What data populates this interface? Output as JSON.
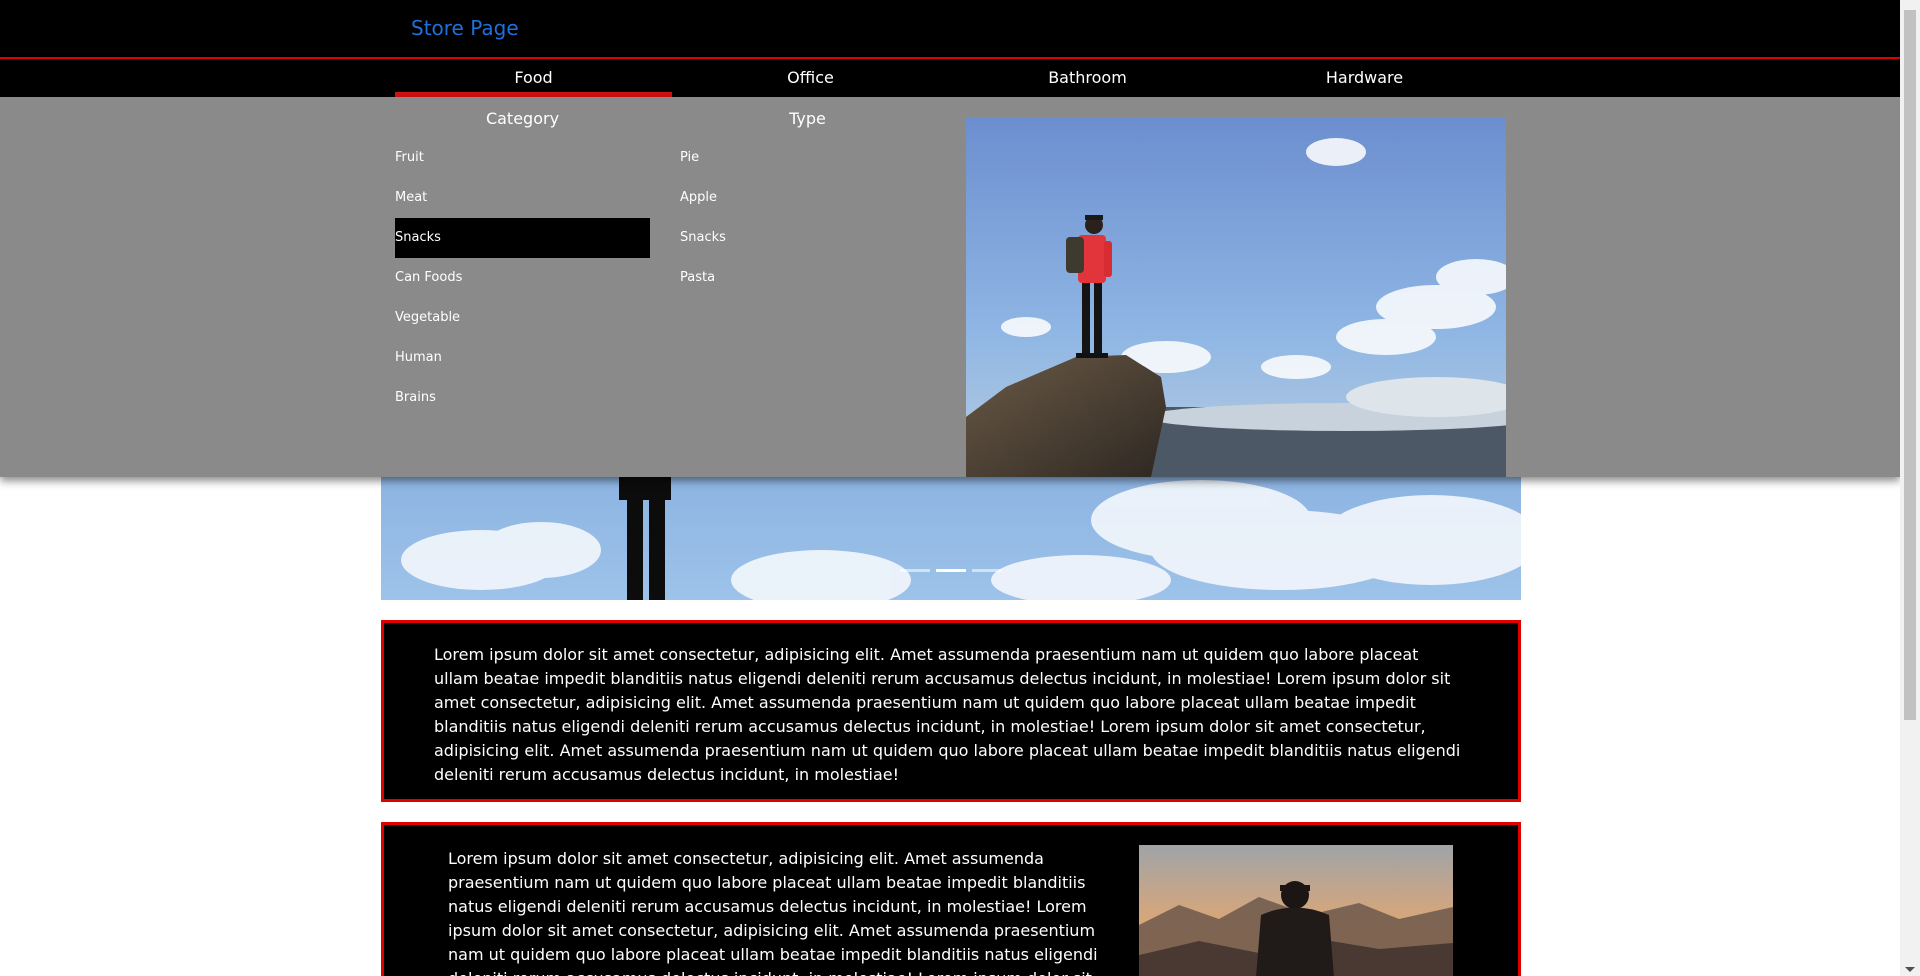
{
  "header": {
    "brand": "Store Page"
  },
  "nav": {
    "tabs": [
      {
        "label": "Food",
        "active": true
      },
      {
        "label": "Office",
        "active": false
      },
      {
        "label": "Bathroom",
        "active": false
      },
      {
        "label": "Hardware",
        "active": false
      }
    ]
  },
  "mega_menu": {
    "category": {
      "title": "Category",
      "items": [
        "Fruit",
        "Meat",
        "Snacks",
        "Can Foods",
        "Vegetable",
        "Human",
        "Brains"
      ],
      "selected": "Snacks"
    },
    "type": {
      "title": "Type",
      "items": [
        "Pie",
        "Apple",
        "Snacks",
        "Pasta"
      ]
    }
  },
  "carousel": {
    "slide_count": 3,
    "active_index": 1
  },
  "content": {
    "card1_text": "Lorem ipsum dolor sit amet consectetur, adipisicing elit. Amet assumenda praesentium nam ut quidem quo labore placeat ullam beatae impedit blanditiis natus eligendi deleniti rerum accusamus delectus incidunt, in molestiae! Lorem ipsum dolor sit amet consectetur, adipisicing elit. Amet assumenda praesentium nam ut quidem quo labore placeat ullam beatae impedit blanditiis natus eligendi deleniti rerum accusamus delectus incidunt, in molestiae! Lorem ipsum dolor sit amet consectetur, adipisicing elit. Amet assumenda praesentium nam ut quidem quo labore placeat ullam beatae impedit blanditiis natus eligendi deleniti rerum accusamus delectus incidunt, in molestiae!",
    "card2_text": "Lorem ipsum dolor sit amet consectetur, adipisicing elit. Amet assumenda praesentium nam ut quidem quo labore placeat ullam beatae impedit blanditiis natus eligendi deleniti rerum accusamus delectus incidunt, in molestiae! Lorem ipsum dolor sit amet consectetur, adipisicing elit. Amet assumenda praesentium nam ut quidem quo labore placeat ullam beatae impedit blanditiis natus eligendi deleniti rerum accusamus delectus incidunt, in molestiae! Lorem ipsum dolor sit amet consectetur, adipisicing elit. Amet assumenda"
  },
  "colors": {
    "accent_red": "#e00000",
    "brand_blue": "#1f6fdc",
    "menu_gray": "#8a8a8a"
  }
}
